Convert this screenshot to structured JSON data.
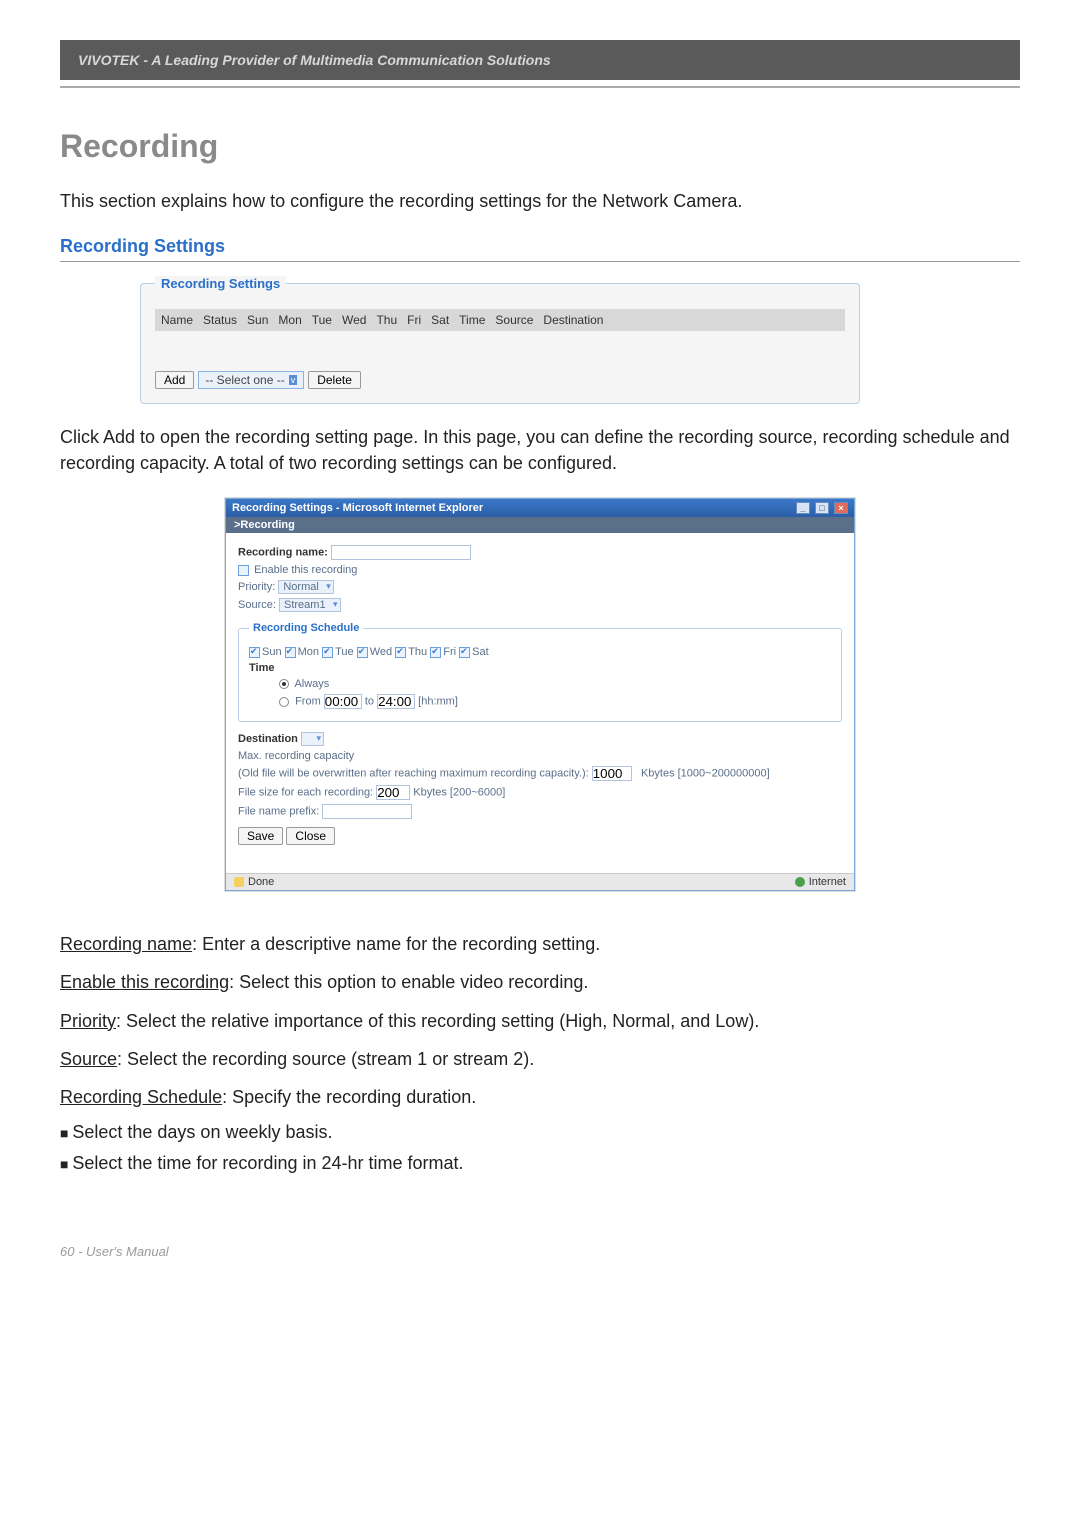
{
  "header": {
    "banner": "VIVOTEK - A Leading Provider of Multimedia Communication Solutions"
  },
  "title": "Recording",
  "intro": "This section explains how to configure the recording settings for the Network Camera.",
  "subhead": "Recording Settings",
  "rs_panel": {
    "legend": "Recording Settings",
    "columns": [
      "Name",
      "Status",
      "Sun",
      "Mon",
      "Tue",
      "Wed",
      "Thu",
      "Fri",
      "Sat",
      "Time",
      "Source",
      "Destination"
    ],
    "add_label": "Add",
    "select_placeholder": "-- Select one --",
    "delete_label": "Delete"
  },
  "para_after": "Click Add to open the recording setting page. In this page, you can define the recording source, recording schedule and recording capacity. A total of two recording settings can be configured.",
  "ie": {
    "title": "Recording Settings - Microsoft Internet Explorer",
    "crumb": ">Recording",
    "recording_name_label": "Recording name:",
    "enable_label": "Enable this recording",
    "priority_label": "Priority:",
    "priority_value": "Normal",
    "source_label": "Source:",
    "source_value": "Stream1",
    "schedule_legend": "Recording Schedule",
    "days": [
      "Sun",
      "Mon",
      "Tue",
      "Wed",
      "Thu",
      "Fri",
      "Sat"
    ],
    "time_label": "Time",
    "always_label": "Always",
    "from_label": "From",
    "from_val": "00:00",
    "to_label": "to",
    "to_val": "24:00",
    "hhmm": "[hh:mm]",
    "destination_label": "Destination",
    "max_cap_label": "Max. recording capacity",
    "overwrite_label": "(Old file will be overwritten after reaching maximum recording capacity.):",
    "overwrite_value": "1000",
    "overwrite_suffix": "Kbytes [1000~200000000]",
    "filesize_label": "File size for each recording:",
    "filesize_value": "200",
    "filesize_suffix": "Kbytes [200~6000]",
    "prefix_label": "File name prefix:",
    "save_label": "Save",
    "close_label": "Close",
    "status_done": "Done",
    "status_zone": "Internet"
  },
  "descriptions": {
    "recording_name_u": "Recording name",
    "recording_name_t": ": Enter a descriptive name for the recording setting.",
    "enable_u": "Enable this recording",
    "enable_t": ": Select this option to enable video recording.",
    "priority_u": "Priority",
    "priority_t": ": Select the relative importance of this recording setting (High, Normal, and Low).",
    "source_u": "Source",
    "source_t": ": Select the recording source (stream 1 or stream 2).",
    "schedule_u": "Recording Schedule",
    "schedule_t": ": Specify the recording duration.",
    "bullet1": "Select the days on weekly basis.",
    "bullet2": "Select the time for recording in 24-hr time format."
  },
  "footer": "60 - User's Manual"
}
